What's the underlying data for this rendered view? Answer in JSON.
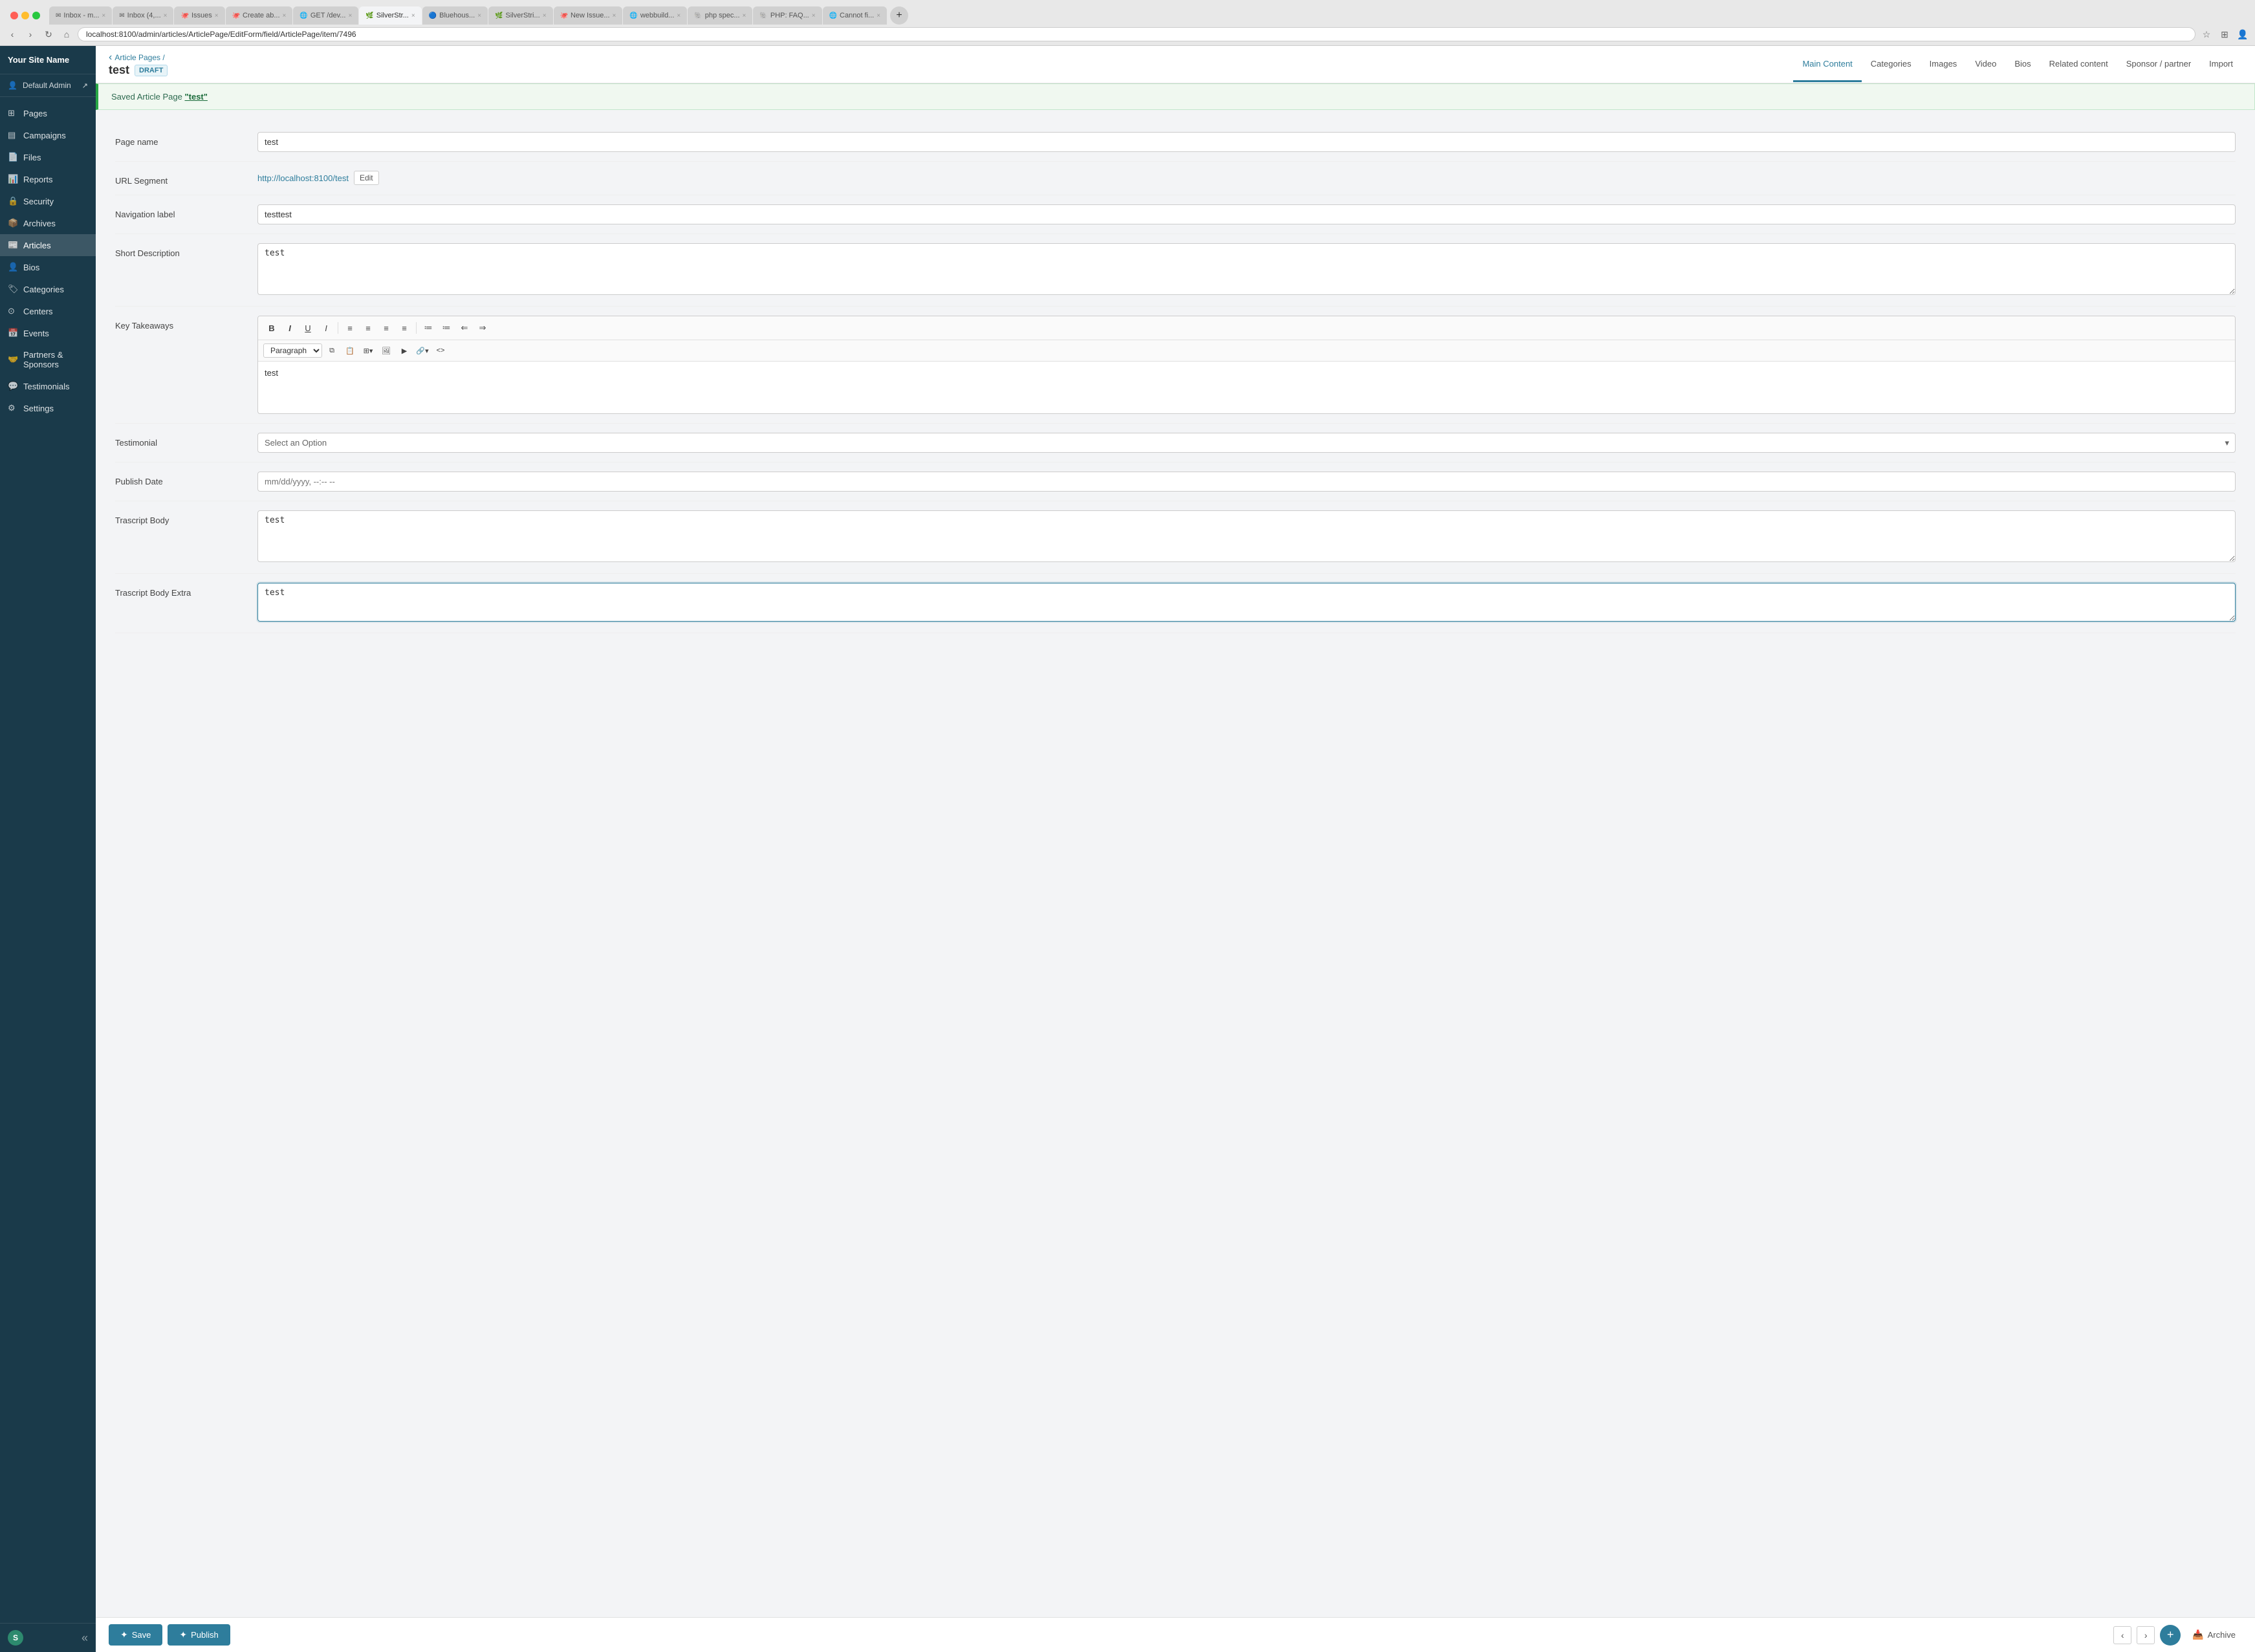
{
  "browser": {
    "url": "localhost:8100/admin/articles/ArticlePage/EditForm/field/ArticlePage/item/7496",
    "tabs": [
      {
        "label": "Inbox - m...",
        "active": false
      },
      {
        "label": "Inbox (4,...",
        "active": false
      },
      {
        "label": "Issues",
        "active": false
      },
      {
        "label": "Create ab...",
        "active": false
      },
      {
        "label": "GET /dev...",
        "active": false
      },
      {
        "label": "SilverStr...",
        "active": true
      },
      {
        "label": "Bluehous...",
        "active": false
      },
      {
        "label": "SilverStri...",
        "active": false
      },
      {
        "label": "New Issue...",
        "active": false
      },
      {
        "label": "webbuild...",
        "active": false
      },
      {
        "label": "php spec...",
        "active": false
      },
      {
        "label": "PHP: FAQ...",
        "active": false
      },
      {
        "label": "Cannot fi...",
        "active": false
      }
    ]
  },
  "sidebar": {
    "site_name": "Your Site Name",
    "user": "Default Admin",
    "items": [
      {
        "label": "Pages",
        "icon": "pages-icon",
        "active": false
      },
      {
        "label": "Campaigns",
        "icon": "campaigns-icon",
        "active": false
      },
      {
        "label": "Files",
        "icon": "files-icon",
        "active": false
      },
      {
        "label": "Reports",
        "icon": "reports-icon",
        "active": false
      },
      {
        "label": "Security",
        "icon": "security-icon",
        "active": false
      },
      {
        "label": "Archives",
        "icon": "archives-icon",
        "active": false
      },
      {
        "label": "Articles",
        "icon": "articles-icon",
        "active": true
      },
      {
        "label": "Bios",
        "icon": "bios-icon",
        "active": false
      },
      {
        "label": "Categories",
        "icon": "categories-icon",
        "active": false
      },
      {
        "label": "Centers",
        "icon": "centers-icon",
        "active": false
      },
      {
        "label": "Events",
        "icon": "events-icon",
        "active": false
      },
      {
        "label": "Partners & Sponsors",
        "icon": "partners-icon",
        "active": false
      },
      {
        "label": "Testimonials",
        "icon": "testimonials-icon",
        "active": false
      },
      {
        "label": "Settings",
        "icon": "settings-icon",
        "active": false
      }
    ]
  },
  "header": {
    "breadcrumb": "Article Pages /",
    "page_title": "test",
    "draft_badge": "DRAFT",
    "nav_tabs": [
      {
        "label": "Main Content",
        "active": true
      },
      {
        "label": "Categories",
        "active": false
      },
      {
        "label": "Images",
        "active": false
      },
      {
        "label": "Video",
        "active": false
      },
      {
        "label": "Bios",
        "active": false
      },
      {
        "label": "Related content",
        "active": false
      },
      {
        "label": "Sponsor / partner",
        "active": false
      },
      {
        "label": "Import",
        "active": false
      }
    ]
  },
  "form": {
    "success_message": "Saved Article Page",
    "success_link_text": "\"test\"",
    "fields": {
      "page_name": {
        "label": "Page name",
        "value": "test"
      },
      "url_segment": {
        "label": "URL Segment",
        "url": "http://localhost:8100/test",
        "edit_btn": "Edit"
      },
      "navigation_label": {
        "label": "Navigation label",
        "value": "testtest"
      },
      "short_description": {
        "label": "Short Description",
        "value": "test"
      },
      "key_takeaways": {
        "label": "Key Takeaways",
        "value": "test"
      },
      "testimonial": {
        "label": "Testimonial",
        "placeholder": "Select an Option"
      },
      "publish_date": {
        "label": "Publish Date",
        "placeholder": "mm/dd/yyyy, --:-- --"
      },
      "trascript_body": {
        "label": "Trascript Body",
        "value": "test"
      },
      "trascript_body_extra": {
        "label": "Trascript Body Extra",
        "value": "test"
      }
    },
    "rte_toolbar": {
      "paragraph_select": "Paragraph",
      "buttons_row1": [
        "B",
        "I",
        "U",
        "I",
        "≡",
        "≡",
        "≡",
        "≡",
        "≡",
        "≡",
        "⊞",
        "⊟"
      ],
      "buttons_row2": [
        "copy",
        "paste",
        "table",
        "img",
        "media",
        "link",
        "code"
      ]
    }
  },
  "bottom_bar": {
    "save_label": "Save",
    "publish_label": "Publish",
    "archive_label": "Archive"
  }
}
